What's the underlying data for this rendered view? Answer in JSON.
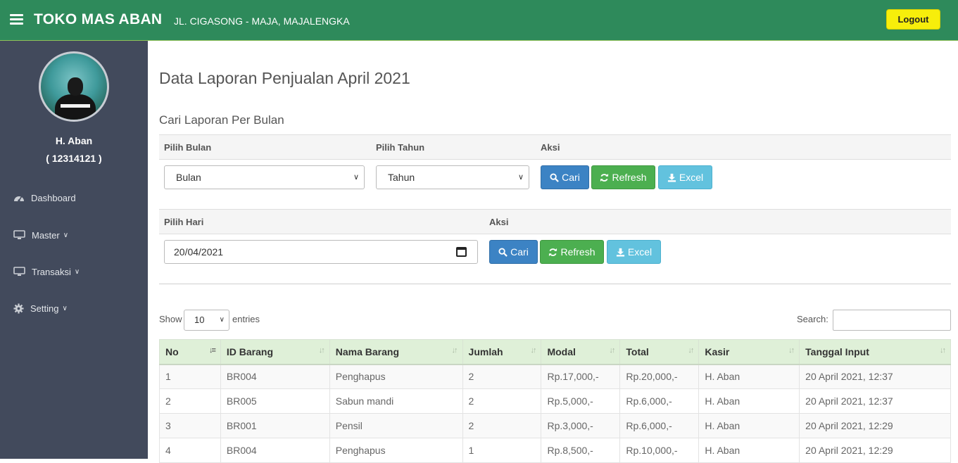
{
  "header": {
    "brand": "TOKO MAS ABAN",
    "address": "JL. CIGASONG - MAJA, MAJALENGKA",
    "logout_label": "Logout"
  },
  "sidebar": {
    "user_name": "H. Aban",
    "user_id": "( 12314121 )",
    "items": [
      {
        "label": "Dashboard",
        "icon": "dashboard-icon"
      },
      {
        "label": "Master",
        "icon": "monitor-icon"
      },
      {
        "label": "Transaksi",
        "icon": "monitor-icon"
      },
      {
        "label": "Setting",
        "icon": "gear-icon"
      }
    ]
  },
  "main": {
    "title": "Data Laporan Penjualan April 2021",
    "section_title": "Cari Laporan Per Bulan",
    "month_filter": {
      "month_label": "Pilih Bulan",
      "year_label": "Pilih Tahun",
      "action_label": "Aksi",
      "month_value": "Bulan",
      "year_value": "Tahun"
    },
    "day_filter": {
      "day_label": "Pilih Hari",
      "action_label": "Aksi",
      "date_value": "20/04/2021"
    },
    "buttons": {
      "search": "Cari",
      "refresh": "Refresh",
      "excel": "Excel"
    },
    "table_controls": {
      "show_label": "Show",
      "entries_value": "10",
      "entries_label": "entries",
      "search_label": "Search:"
    },
    "table": {
      "headers": [
        "No",
        "ID Barang",
        "Nama Barang",
        "Jumlah",
        "Modal",
        "Total",
        "Kasir",
        "Tanggal Input"
      ],
      "rows": [
        [
          "1",
          "BR004",
          "Penghapus",
          "2",
          "Rp.17,000,-",
          "Rp.20,000,-",
          "H. Aban",
          "20 April 2021, 12:37"
        ],
        [
          "2",
          "BR005",
          "Sabun mandi",
          "2",
          "Rp.5,000,-",
          "Rp.6,000,-",
          "H. Aban",
          "20 April 2021, 12:37"
        ],
        [
          "3",
          "BR001",
          "Pensil",
          "2",
          "Rp.3,000,-",
          "Rp.6,000,-",
          "H. Aban",
          "20 April 2021, 12:29"
        ],
        [
          "4",
          "BR004",
          "Penghapus",
          "1",
          "Rp.8,500,-",
          "Rp.10,000,-",
          "H. Aban",
          "20 April 2021, 12:29"
        ]
      ]
    }
  },
  "colors": {
    "topbar": "#2e8a5b",
    "sidebar": "#424a5c",
    "logout": "#f7ee0b",
    "btn_blue": "#3c83c4",
    "btn_green": "#4caf50",
    "btn_cyan": "#62c2de",
    "table_header": "#dff0d8"
  }
}
